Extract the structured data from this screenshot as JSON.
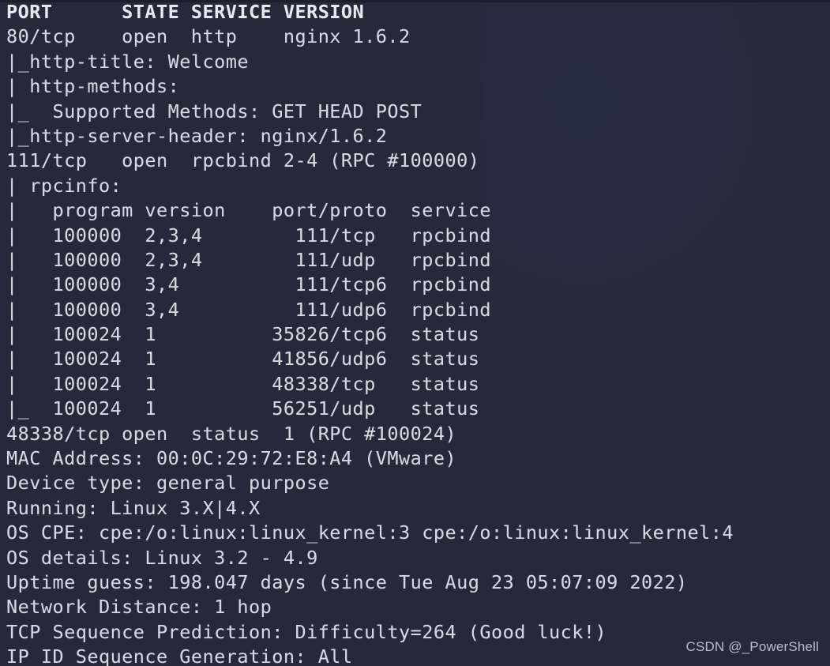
{
  "terminal": {
    "background_color": "#252939",
    "text_color": "#d6dae0",
    "header_color": "#e6eaef",
    "lines": [
      "PORT      STATE SERVICE VERSION",
      "80/tcp    open  http    nginx 1.6.2",
      "|_http-title: Welcome",
      "| http-methods:",
      "|_  Supported Methods: GET HEAD POST",
      "|_http-server-header: nginx/1.6.2",
      "111/tcp   open  rpcbind 2-4 (RPC #100000)",
      "| rpcinfo:",
      "|   program version    port/proto  service",
      "|   100000  2,3,4        111/tcp   rpcbind",
      "|   100000  2,3,4        111/udp   rpcbind",
      "|   100000  3,4          111/tcp6  rpcbind",
      "|   100000  3,4          111/udp6  rpcbind",
      "|   100024  1          35826/tcp6  status",
      "|   100024  1          41856/udp6  status",
      "|   100024  1          48338/tcp   status",
      "|_  100024  1          56251/udp   status",
      "48338/tcp open  status  1 (RPC #100024)",
      "MAC Address: 00:0C:29:72:E8:A4 (VMware)",
      "Device type: general purpose",
      "Running: Linux 3.X|4.X",
      "OS CPE: cpe:/o:linux:linux_kernel:3 cpe:/o:linux:linux_kernel:4",
      "OS details: Linux 3.2 - 4.9",
      "Uptime guess: 198.047 days (since Tue Aug 23 05:07:09 2022)",
      "Network Distance: 1 hop",
      "TCP Sequence Prediction: Difficulty=264 (Good luck!)",
      "IP ID Sequence Generation: All"
    ],
    "header_line_index": 0,
    "scan_summary": {
      "ports": [
        {
          "port": "80/tcp",
          "state": "open",
          "service": "http",
          "version": "nginx 1.6.2"
        },
        {
          "port": "111/tcp",
          "state": "open",
          "service": "rpcbind",
          "version": "2-4 (RPC #100000)"
        },
        {
          "port": "48338/tcp",
          "state": "open",
          "service": "status",
          "version": "1 (RPC #100024)"
        }
      ],
      "rpcinfo_columns": [
        "program",
        "version",
        "port/proto",
        "service"
      ],
      "rpcinfo_rows": [
        [
          "100000",
          "2,3,4",
          "111/tcp",
          "rpcbind"
        ],
        [
          "100000",
          "2,3,4",
          "111/udp",
          "rpcbind"
        ],
        [
          "100000",
          "3,4",
          "111/tcp6",
          "rpcbind"
        ],
        [
          "100000",
          "3,4",
          "111/udp6",
          "rpcbind"
        ],
        [
          "100024",
          "1",
          "35826/tcp6",
          "status"
        ],
        [
          "100024",
          "1",
          "41856/udp6",
          "status"
        ],
        [
          "100024",
          "1",
          "48338/tcp",
          "status"
        ],
        [
          "100024",
          "1",
          "56251/udp",
          "status"
        ]
      ],
      "mac_address": "00:0C:29:72:E8:A4 (VMware)",
      "device_type": "general purpose",
      "running": "Linux 3.X|4.X",
      "os_cpe": "cpe:/o:linux:linux_kernel:3 cpe:/o:linux:linux_kernel:4",
      "os_details": "Linux 3.2 - 4.9",
      "uptime_guess": "198.047 days (since Tue Aug 23 05:07:09 2022)",
      "network_distance": "1 hop",
      "tcp_sequence_prediction": "Difficulty=264 (Good luck!)",
      "ip_id_sequence_generation": "All"
    }
  },
  "watermark": {
    "text": "CSDN @_PowerShell"
  }
}
